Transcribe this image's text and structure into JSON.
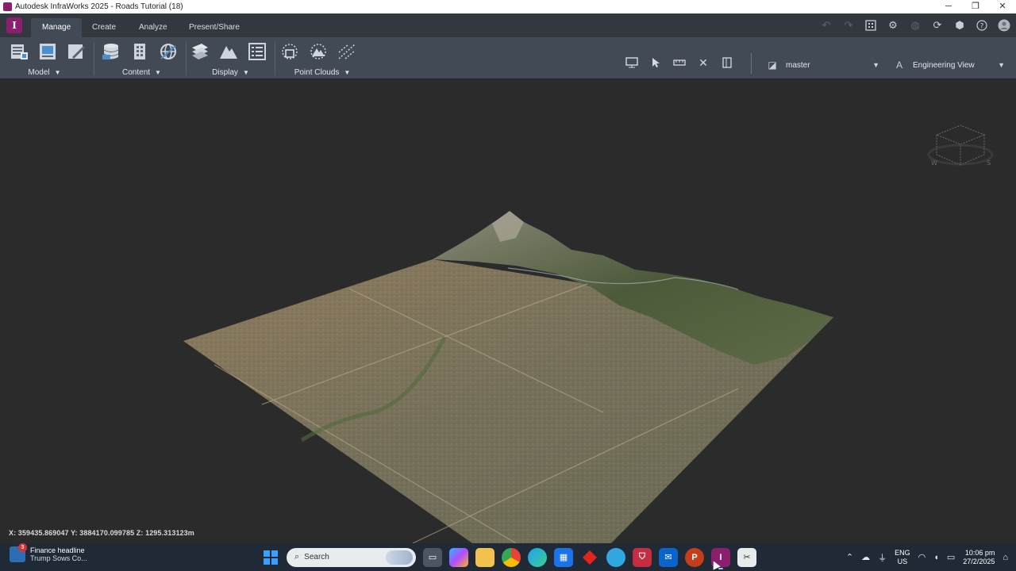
{
  "window": {
    "title": "Autodesk InfraWorks 2025 - Roads Tutorial (18)",
    "controls": [
      "─",
      "❐",
      "✕"
    ]
  },
  "ribbon": {
    "logo": "I",
    "tabs": [
      {
        "label": "Manage",
        "active": true
      },
      {
        "label": "Create",
        "active": false
      },
      {
        "label": "Analyze",
        "active": false
      },
      {
        "label": "Present/Share",
        "active": false
      }
    ],
    "groups": {
      "model": "Model",
      "content": "Content",
      "display": "Display",
      "point_clouds": "Point Clouds"
    },
    "caret": "▼",
    "proposal": "master",
    "view": "Engineering View"
  },
  "viewcube": {
    "left": "W",
    "right": "S"
  },
  "status": {
    "coordinates": "X: 359435.869047 Y: 3884170.099785 Z: 1295.313123m"
  },
  "taskbar": {
    "news_badge": "3",
    "news_title": "Finance headline",
    "news_sub": "Trump Sows Co...",
    "search_placeholder": "Search",
    "lang_1": "ENG",
    "lang_2": "US",
    "time": "10:06 pm",
    "date": "27/2/2025"
  },
  "colors": {
    "brand": "#8a1f6e",
    "ribbon_bg": "#424a55",
    "viewport_bg": "#2b2b2b",
    "taskbar_bg": "#1f2a36"
  }
}
